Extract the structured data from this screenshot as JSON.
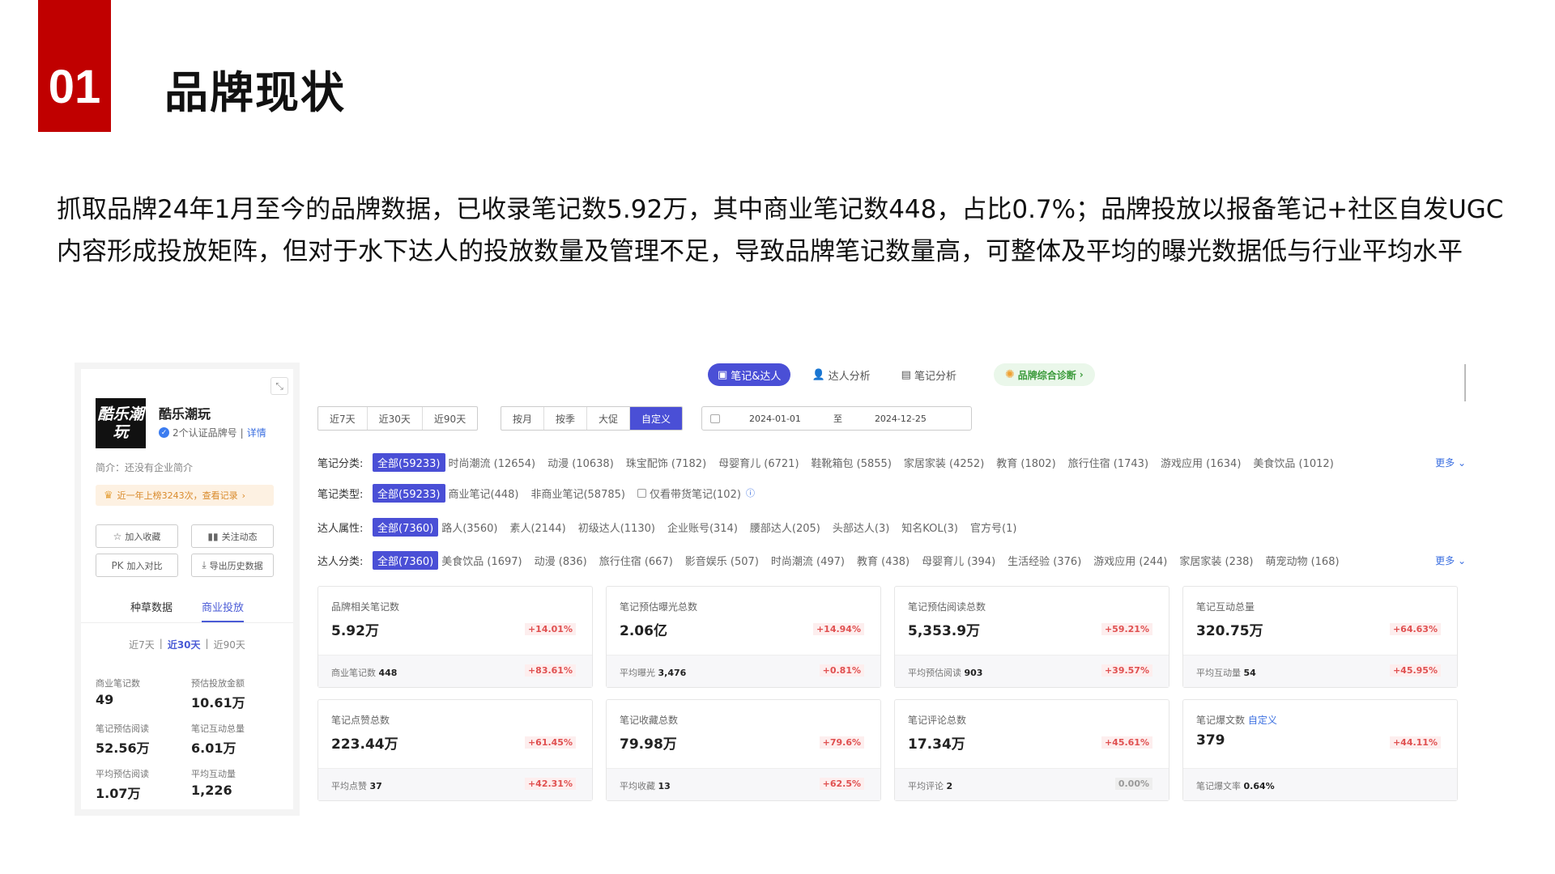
{
  "slide": {
    "number": "01",
    "title": "品牌现状",
    "intro": "抓取品牌24年1月至今的品牌数据，已收录笔记数5.92万，其中商业笔记数448，占比0.7%；品牌投放以报备笔记+社区自发UGC内容形成投放矩阵，但对于水下达人的投放数量及管理不足，导致品牌笔记数量高，可整体及平均的曝光数据低与行业平均水平"
  },
  "left_panel": {
    "logo_text": "酷乐潮玩",
    "brand_name": "酷乐潮玩",
    "cert_text": "2个认证品牌号",
    "cert_separator": "|",
    "cert_link": "详情",
    "description": "简介：还没有企业简介",
    "rank_text": "近一年上榜3243次，查看记录",
    "buttons": {
      "favorite": "加入收藏",
      "follow": "关注动态",
      "compare": "加入对比",
      "export": "导出历史数据"
    },
    "compare_prefix": "PK",
    "tabs": [
      "种草数据",
      "商业投放"
    ],
    "periods": [
      "近7天",
      "近30天",
      "近90天"
    ],
    "period_separator": "|",
    "stats": [
      {
        "label": "商业笔记数",
        "value": "49"
      },
      {
        "label": "预估投放金额",
        "value": "10.61万"
      },
      {
        "label": "笔记预估阅读",
        "value": "52.56万"
      },
      {
        "label": "笔记互动总量",
        "value": "6.01万"
      },
      {
        "label": "平均预估阅读",
        "value": "1.07万"
      },
      {
        "label": "平均互动量",
        "value": "1,226"
      }
    ]
  },
  "top_tabs": {
    "items": [
      "笔记&达人",
      "达人分析",
      "笔记分析"
    ],
    "diagnose": "品牌综合诊断"
  },
  "time_filters": {
    "quick": [
      "近7天",
      "近30天",
      "近90天"
    ],
    "mode": [
      "按月",
      "按季",
      "大促",
      "自定义"
    ],
    "date_start": "2024-01-01",
    "date_sep": "至",
    "date_end": "2024-12-25"
  },
  "filters": {
    "note_category": {
      "label": "笔记分类:",
      "selected": "全部(59233)",
      "items": [
        "时尚潮流 (12654)",
        "动漫 (10638)",
        "珠宝配饰 (7182)",
        "母婴育儿 (6721)",
        "鞋靴箱包 (5855)",
        "家居家装 (4252)",
        "教育 (1802)",
        "旅行住宿 (1743)",
        "游戏应用 (1634)",
        "美食饮品 (1012)"
      ],
      "more": "更多 ⌄"
    },
    "note_type": {
      "label": "笔记类型:",
      "selected": "全部(59233)",
      "items": [
        "商业笔记(448)",
        "非商业笔记(58785)"
      ],
      "checkbox": "仅看带货笔记(102)"
    },
    "creator_attr": {
      "label": "达人属性:",
      "selected": "全部(7360)",
      "items": [
        "路人(3560)",
        "素人(2144)",
        "初级达人(1130)",
        "企业账号(314)",
        "腰部达人(205)",
        "头部达人(3)",
        "知名KOL(3)",
        "官方号(1)"
      ]
    },
    "creator_category": {
      "label": "达人分类:",
      "selected": "全部(7360)",
      "items": [
        "美食饮品 (1697)",
        "动漫 (836)",
        "旅行住宿 (667)",
        "影音娱乐 (507)",
        "时尚潮流 (497)",
        "教育 (438)",
        "母婴育儿 (394)",
        "生活经验 (376)",
        "游戏应用 (244)",
        "家居家装 (238)",
        "萌宠动物 (168)"
      ],
      "more": "更多 ⌄"
    }
  },
  "cards": [
    {
      "title": "品牌相关笔记数",
      "value": "5.92万",
      "delta": "+14.01%",
      "sub_label": "商业笔记数",
      "sub_value": "448",
      "sub_delta": "+83.61%"
    },
    {
      "title": "笔记预估曝光总数",
      "value": "2.06亿",
      "delta": "+14.94%",
      "sub_label": "平均曝光",
      "sub_value": "3,476",
      "sub_delta": "+0.81%"
    },
    {
      "title": "笔记预估阅读总数",
      "value": "5,353.9万",
      "delta": "+59.21%",
      "sub_label": "平均预估阅读",
      "sub_value": "903",
      "sub_delta": "+39.57%"
    },
    {
      "title": "笔记互动总量",
      "value": "320.75万",
      "delta": "+64.63%",
      "sub_label": "平均互动量",
      "sub_value": "54",
      "sub_delta": "+45.95%"
    },
    {
      "title": "笔记点赞总数",
      "value": "223.44万",
      "delta": "+61.45%",
      "sub_label": "平均点赞",
      "sub_value": "37",
      "sub_delta": "+42.31%"
    },
    {
      "title": "笔记收藏总数",
      "value": "79.98万",
      "delta": "+79.6%",
      "sub_label": "平均收藏",
      "sub_value": "13",
      "sub_delta": "+62.5%"
    },
    {
      "title": "笔记评论总数",
      "value": "17.34万",
      "delta": "+45.61%",
      "sub_label": "平均评论",
      "sub_value": "2",
      "sub_delta": "0.00%"
    },
    {
      "title": "笔记爆文数",
      "title_link": "自定义",
      "value": "379",
      "delta": "+44.11%",
      "sub_label": "笔记爆文率",
      "sub_value": "0.64%",
      "sub_delta": ""
    }
  ],
  "colors": {
    "accent_red": "#c00000",
    "brand_purple": "#4a4fd6",
    "delta_red": "#e05050"
  }
}
